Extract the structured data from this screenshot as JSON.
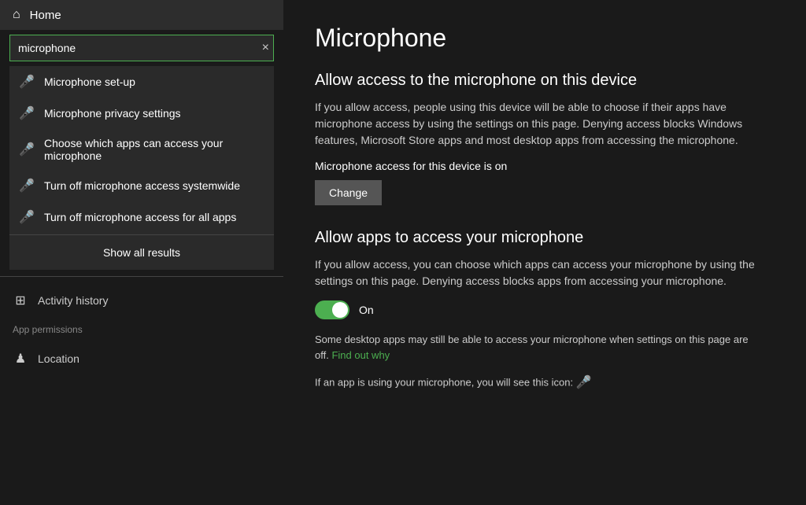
{
  "sidebar": {
    "home_label": "Home",
    "search": {
      "value": "microphone",
      "placeholder": "microphone",
      "clear_label": "×"
    },
    "results": [
      {
        "id": "microphone-setup",
        "label": "Microphone set-up"
      },
      {
        "id": "microphone-privacy",
        "label": "Microphone privacy settings"
      },
      {
        "id": "choose-apps",
        "label": "Choose which apps can access your microphone"
      },
      {
        "id": "turn-off-systemwide",
        "label": "Turn off microphone access systemwide"
      },
      {
        "id": "turn-off-all-apps",
        "label": "Turn off microphone access for all apps"
      }
    ],
    "show_all_label": "Show all results",
    "activity_history_label": "Activity history",
    "app_permissions_label": "App permissions",
    "location_label": "Location"
  },
  "main": {
    "page_title": "Microphone",
    "section1": {
      "title": "Allow access to the microphone on this device",
      "body": "If you allow access, people using this device will be able to choose if their apps have microphone access by using the settings on this page. Denying access blocks Windows features, Microsoft Store apps and most desktop apps from accessing the microphone.",
      "status": "Microphone access for this device is on",
      "change_button": "Change"
    },
    "section2": {
      "title": "Allow apps to access your microphone",
      "body": "If you allow access, you can choose which apps can access your microphone by using the settings on this page. Denying access blocks apps from accessing your microphone.",
      "toggle_label": "On",
      "note1_before": "Some desktop apps may still be able to access your microphone when settings on this page are off.",
      "find_out_why": "Find out why",
      "note2_before": "If an app is using your microphone, you will see this icon:"
    }
  }
}
